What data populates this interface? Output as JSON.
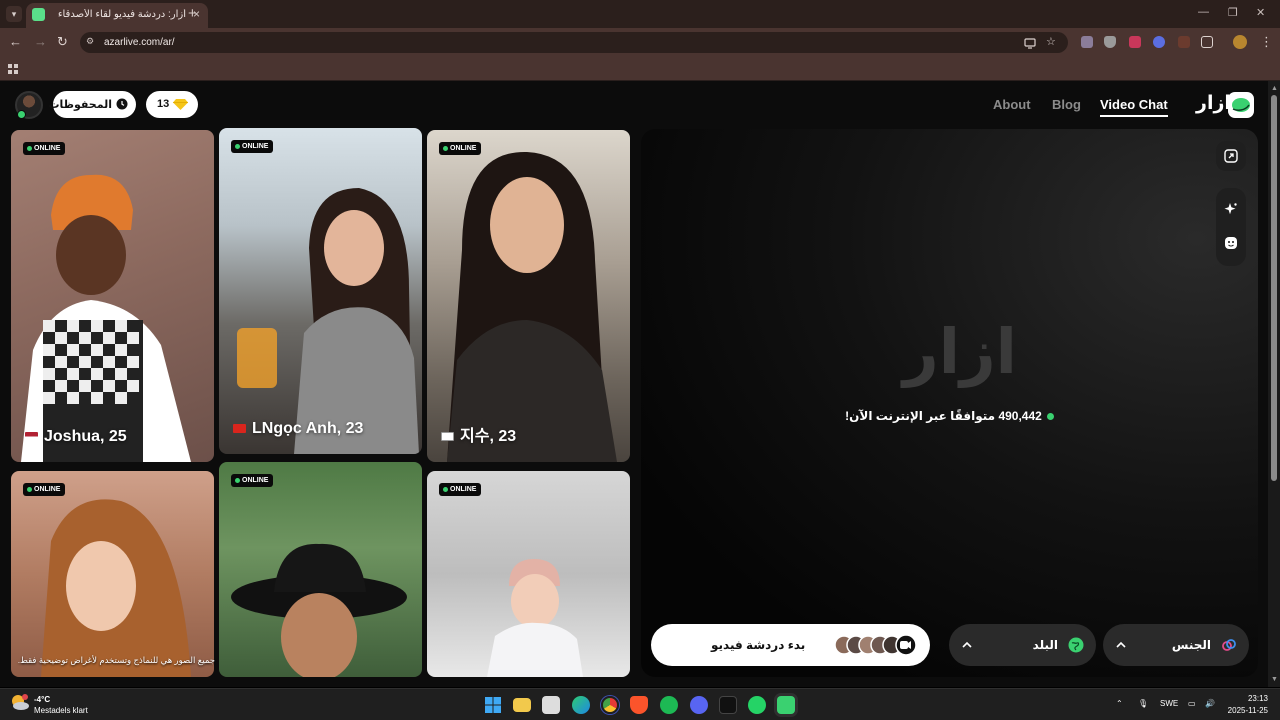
{
  "browser": {
    "tab_title": "أزار: دردشة فيديو لقاء الأصدقاء",
    "tab_close": "×",
    "new_tab": "+",
    "url": "azarlive.com/ar/",
    "window_controls": [
      "—",
      "❐",
      "✕"
    ]
  },
  "header": {
    "saved_label": "المحفوظات",
    "gems_count": "13",
    "nav": [
      "About",
      "Blog",
      "Video Chat"
    ],
    "brand_text": "ازار"
  },
  "cards": [
    {
      "name": "Joshua, 25",
      "badge": "ONLINE"
    },
    {
      "name": "LNgọc Anh, 23",
      "badge": "ONLINE"
    },
    {
      "name": "지수, 23",
      "badge": "ONLINE"
    },
    {
      "name": "",
      "badge": "ONLINE"
    },
    {
      "name": "",
      "badge": "ONLINE"
    },
    {
      "name": "",
      "badge": "ONLINE"
    }
  ],
  "disclaimer": "جميع الصور هي للنماذج وتستخدم لأغراض توضيحية فقط.",
  "video": {
    "logo": "ازار",
    "online_count": "490,442 متوافقًا عبر الإنترنت الآن!"
  },
  "controls": {
    "start_label": "بدء دردشة فيديو",
    "country_label": "البلد",
    "gender_label": "الجنس"
  },
  "taskbar": {
    "temp": "-4°C",
    "weather": "Mestadels klart",
    "lang": "SWE",
    "time": "23:13",
    "date": "2025-11-25"
  },
  "colors": {
    "accent_green": "#3ad170",
    "chrome_dark": "#2b1f1c",
    "chrome_tab": "#4a3430"
  }
}
